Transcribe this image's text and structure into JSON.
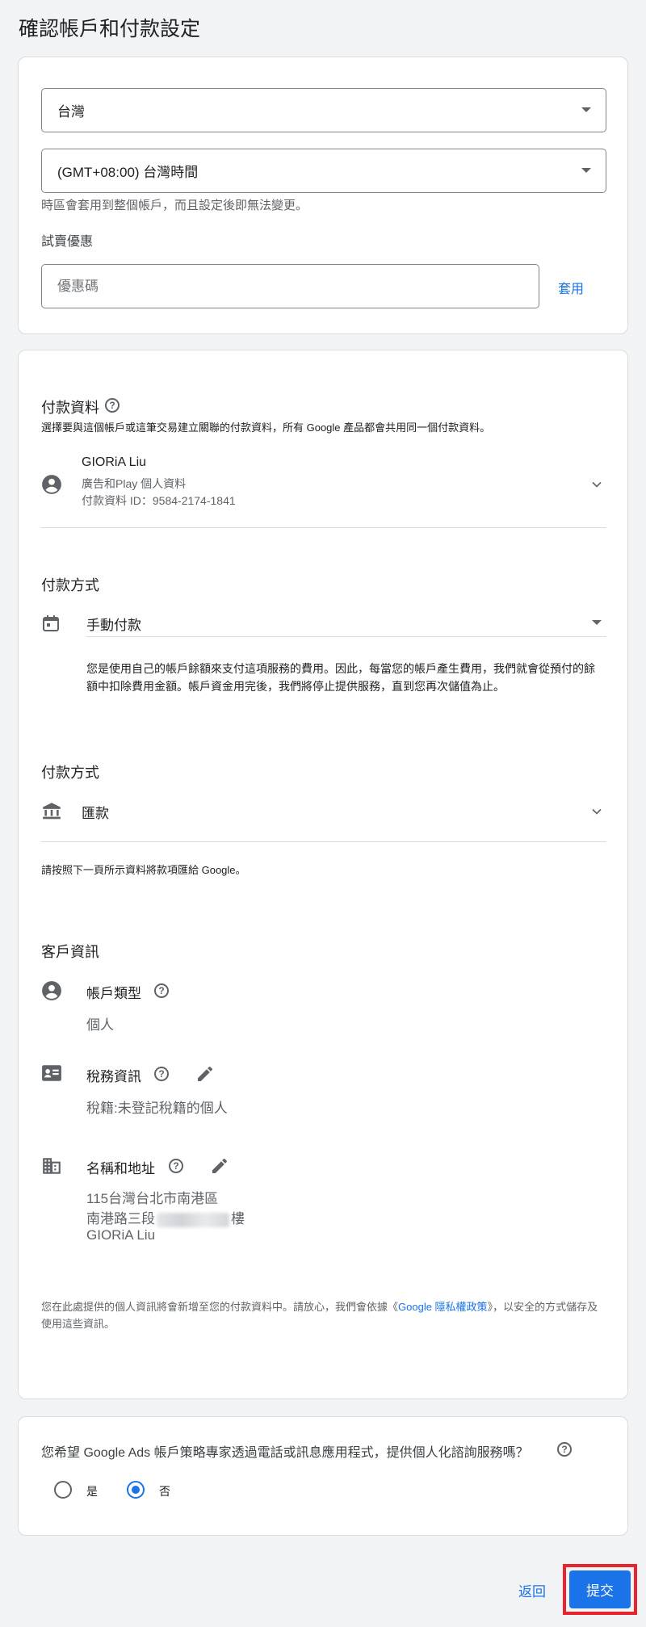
{
  "page": {
    "title": "確認帳戶和付款設定"
  },
  "settings": {
    "country": "台灣",
    "timezone": "(GMT+08:00) 台灣時間",
    "timezone_hint": "時區會套用到整個帳戶，而且設定後即無法變更。",
    "promo_label": "試賣優惠",
    "promo_placeholder": "優惠碼",
    "apply_label": "套用"
  },
  "payment_profile": {
    "heading": "付款資料",
    "description": "選擇要與這個帳戶或這筆交易建立關聯的付款資料，所有 Google 產品都會共用同一個付款資料。",
    "name": "GIORiA Liu",
    "type": "廣告和Play 個人資料",
    "id_label": "付款資料 ID：9584-2174-1841"
  },
  "payment_method_1": {
    "heading": "付款方式",
    "value": "手動付款",
    "description": "您是使用自己的帳戶餘額來支付這項服務的費用。因此，每當您的帳戶產生費用，我們就會從預付的餘額中扣除費用金額。帳戶資金用完後，我們將停止提供服務，直到您再次儲值為止。"
  },
  "payment_method_2": {
    "heading": "付款方式",
    "value": "匯款",
    "note": "請按照下一頁所示資料將款項匯給 Google。"
  },
  "customer": {
    "heading": "客戶資訊",
    "account_type_label": "帳戶類型",
    "account_type_value": "個人",
    "tax_label": "稅務資訊",
    "tax_value": "稅籍:未登記稅籍的個人",
    "address_label": "名稱和地址",
    "address_line1": "115台灣台北市南港區",
    "address_line2_prefix": "南港路三段",
    "address_line2_suffix": "樓",
    "address_line3": "GIORiA Liu",
    "privacy_pre": "您在此處提供的個人資訊將會新增至您的付款資料中。請放心，我們會依據《",
    "privacy_link": "Google 隱私權政策",
    "privacy_post": "》，以安全的方式儲存及使用這些資訊。"
  },
  "consult": {
    "question": "您希望 Google Ads 帳戶策略專家透過電話或訊息應用程式，提供個人化諮詢服務嗎？",
    "yes_label": "是",
    "no_label": "否",
    "selected": "否"
  },
  "footer": {
    "back_label": "返回",
    "submit_label": "提交"
  },
  "colors": {
    "accent": "#1a73e8",
    "highlight_border": "#e8232b",
    "page_bg": "#f1f3f4"
  }
}
